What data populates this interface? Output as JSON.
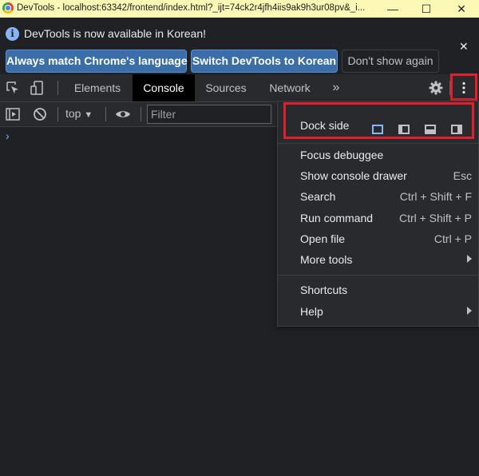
{
  "window": {
    "title": "DevTools - localhost:63342/frontend/index.html?_ijt=74ck2r4jfh4iis9ak9h3ur08pv&_i...",
    "minimize": "—",
    "maximize": "☐",
    "close": "✕"
  },
  "infobar": {
    "message": "DevTools is now available in Korean!",
    "buttons": {
      "match": "Always match Chrome's language",
      "switch": "Switch DevTools to Korean",
      "dont_show": "Don't show again"
    },
    "close": "✕"
  },
  "tabs": {
    "elements": "Elements",
    "console": "Console",
    "sources": "Sources",
    "network": "Network",
    "more": "»",
    "active": "Console"
  },
  "console_toolbar": {
    "context": "top",
    "filter_placeholder": "Filter"
  },
  "console": {
    "prompt": "›"
  },
  "menu": {
    "dock_side": "Dock side",
    "items": [
      {
        "label": "Focus debuggee",
        "shortcut": ""
      },
      {
        "label": "Show console drawer",
        "shortcut": "Esc"
      },
      {
        "label": "Search",
        "shortcut": "Ctrl + Shift + F"
      },
      {
        "label": "Run command",
        "shortcut": "Ctrl + Shift + P"
      },
      {
        "label": "Open file",
        "shortcut": "Ctrl + P"
      },
      {
        "label": "More tools",
        "shortcut": ""
      },
      {
        "label": "Shortcuts",
        "shortcut": ""
      },
      {
        "label": "Help",
        "shortcut": ""
      }
    ]
  },
  "colors": {
    "title_bar": "#fbf9b5",
    "panel_bg": "#202124",
    "toolbar_bg": "#292a2d",
    "accent": "#8ab4f8",
    "primary_button": "#3b6ea8",
    "highlight": "#e0202f"
  }
}
